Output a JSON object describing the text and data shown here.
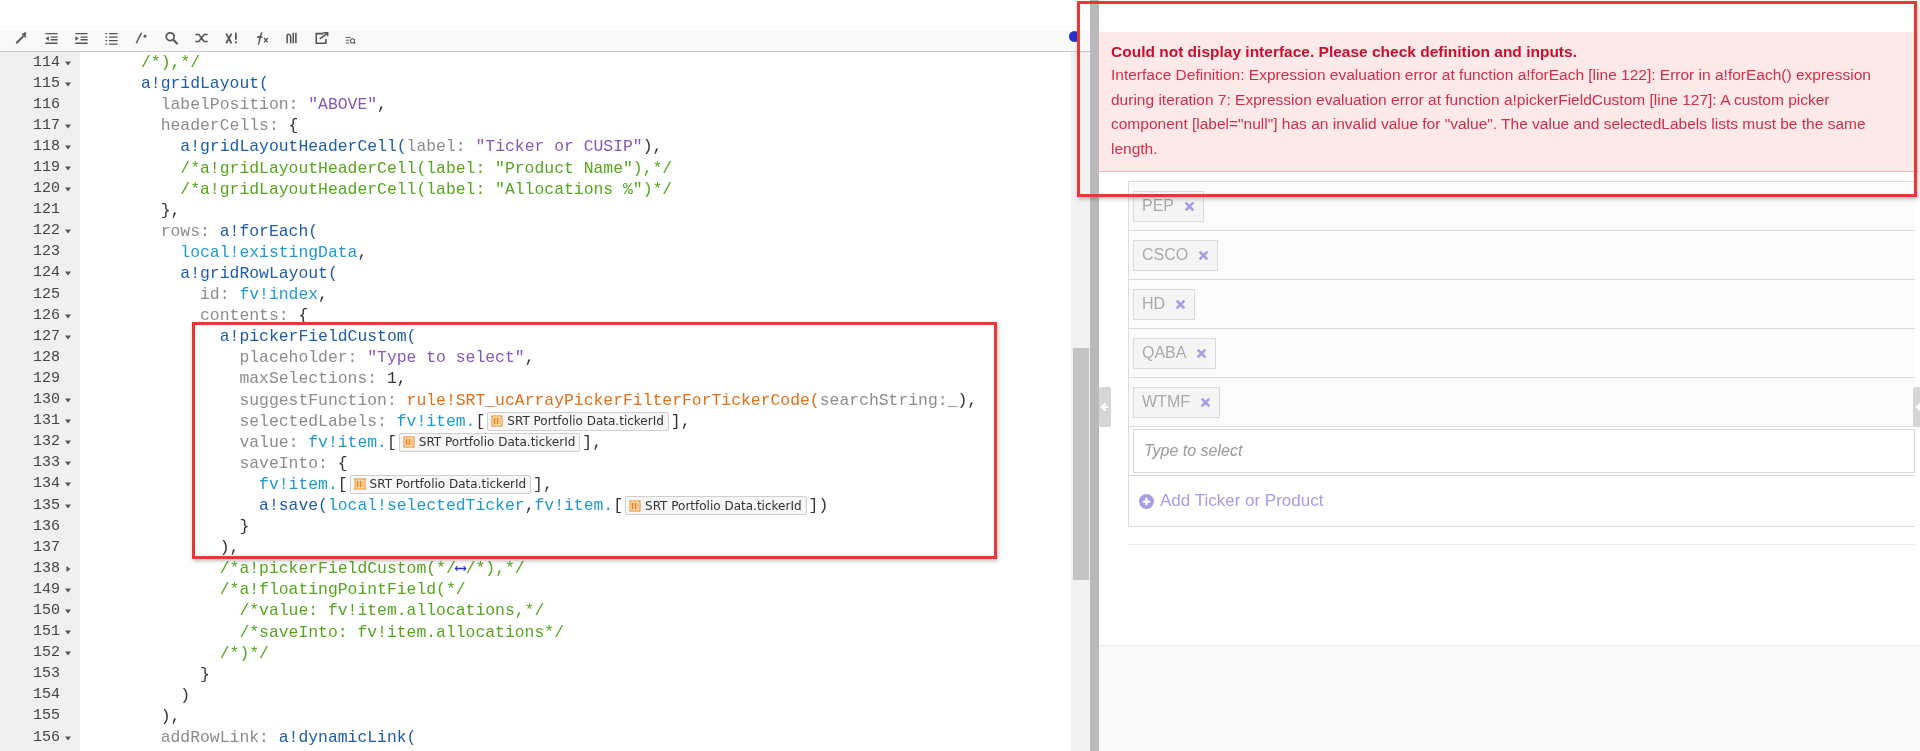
{
  "editor": {
    "lines": [
      {
        "number": "114",
        "expanded": true,
        "tokens": [
          {
            "kind": "cmt",
            "text": "      /*),*/"
          }
        ]
      },
      {
        "number": "115",
        "expanded": true,
        "tokens": [
          {
            "kind": "fn",
            "text": "      a!gridLayout("
          }
        ]
      },
      {
        "number": "116",
        "tokens": [
          {
            "kind": "key",
            "text": "        labelPosition: "
          },
          {
            "kind": "str",
            "text": "\"ABOVE\""
          },
          {
            "kind": "punct",
            "text": ","
          }
        ]
      },
      {
        "number": "117",
        "expanded": true,
        "tokens": [
          {
            "kind": "key",
            "text": "        headerCells: "
          },
          {
            "kind": "punct",
            "text": "{"
          }
        ]
      },
      {
        "number": "118",
        "expanded": true,
        "tokens": [
          {
            "kind": "fn",
            "text": "          a!gridLayoutHeaderCell("
          },
          {
            "kind": "key",
            "text": "label: "
          },
          {
            "kind": "str",
            "text": "\"Ticker or CUSIP\""
          },
          {
            "kind": "punct",
            "text": "),"
          }
        ]
      },
      {
        "number": "119",
        "expanded": true,
        "tokens": [
          {
            "kind": "cmt",
            "text": "          /*a!gridLayoutHeaderCell(label: \"Product Name\"),*/"
          }
        ]
      },
      {
        "number": "120",
        "expanded": true,
        "tokens": [
          {
            "kind": "cmt",
            "text": "          /*a!gridLayoutHeaderCell(label: \"Allocations %\")*/"
          }
        ]
      },
      {
        "number": "121",
        "tokens": [
          {
            "kind": "punct",
            "text": "        },"
          }
        ]
      },
      {
        "number": "122",
        "expanded": true,
        "tokens": [
          {
            "kind": "key",
            "text": "        rows: "
          },
          {
            "kind": "fn",
            "text": "a!forEach("
          }
        ]
      },
      {
        "number": "123",
        "tokens": [
          {
            "kind": "var",
            "text": "          local!existingData"
          },
          {
            "kind": "punct",
            "text": ","
          }
        ]
      },
      {
        "number": "124",
        "expanded": true,
        "tokens": [
          {
            "kind": "fn",
            "text": "          a!gridRowLayout("
          }
        ]
      },
      {
        "number": "125",
        "tokens": [
          {
            "kind": "key",
            "text": "            id: "
          },
          {
            "kind": "var",
            "text": "fv!index"
          },
          {
            "kind": "punct",
            "text": ","
          }
        ]
      },
      {
        "number": "126",
        "expanded": true,
        "tokens": [
          {
            "kind": "key",
            "text": "            contents: "
          },
          {
            "kind": "punct",
            "text": "{"
          }
        ]
      },
      {
        "number": "127",
        "expanded": true,
        "tokens": [
          {
            "kind": "fn",
            "text": "              a!pickerFieldCustom("
          }
        ]
      },
      {
        "number": "128",
        "tokens": [
          {
            "kind": "key",
            "text": "                placeholder: "
          },
          {
            "kind": "str",
            "text": "\"Type to select\""
          },
          {
            "kind": "punct",
            "text": ","
          }
        ]
      },
      {
        "number": "129",
        "tokens": [
          {
            "kind": "key",
            "text": "                maxSelections: "
          },
          {
            "kind": "punct",
            "text": "1,"
          }
        ]
      },
      {
        "number": "130",
        "expanded": true,
        "tokens": [
          {
            "kind": "key",
            "text": "                suggestFunction: "
          },
          {
            "kind": "rule",
            "text": "rule!SRT_ucArrayPickerFilterForTickerCode("
          },
          {
            "kind": "key",
            "text": "searchString:_"
          },
          {
            "kind": "punct",
            "text": "),"
          }
        ]
      },
      {
        "number": "131",
        "expanded": true,
        "tokens": [
          {
            "kind": "key",
            "text": "                selectedLabels: "
          },
          {
            "kind": "var",
            "text": "fv!item."
          },
          {
            "kind": "punct",
            "text": "["
          },
          {
            "kind": "rec",
            "text": "SRT Portfolio Data.tickerId"
          },
          {
            "kind": "punct",
            "text": "],"
          }
        ]
      },
      {
        "number": "132",
        "expanded": true,
        "tokens": [
          {
            "kind": "key",
            "text": "                value: "
          },
          {
            "kind": "var",
            "text": "fv!item."
          },
          {
            "kind": "punct",
            "text": "["
          },
          {
            "kind": "rec",
            "text": "SRT Portfolio Data.tickerId"
          },
          {
            "kind": "punct",
            "text": "],"
          }
        ]
      },
      {
        "number": "133",
        "expanded": true,
        "tokens": [
          {
            "kind": "key",
            "text": "                saveInto: "
          },
          {
            "kind": "punct",
            "text": "{"
          }
        ]
      },
      {
        "number": "134",
        "expanded": true,
        "tokens": [
          {
            "kind": "var",
            "text": "                  fv!item."
          },
          {
            "kind": "punct",
            "text": "["
          },
          {
            "kind": "rec",
            "text": "SRT Portfolio Data.tickerId"
          },
          {
            "kind": "punct",
            "text": "],"
          }
        ]
      },
      {
        "number": "135",
        "expanded": true,
        "tokens": [
          {
            "kind": "fn",
            "text": "                  a!save("
          },
          {
            "kind": "var",
            "text": "local!selectedTicker"
          },
          {
            "kind": "punct",
            "text": ","
          },
          {
            "kind": "var",
            "text": "fv!item."
          },
          {
            "kind": "punct",
            "text": "["
          },
          {
            "kind": "rec",
            "text": "SRT Portfolio Data.tickerId"
          },
          {
            "kind": "punct",
            "text": "])"
          }
        ]
      },
      {
        "number": "136",
        "tokens": [
          {
            "kind": "punct",
            "text": "                }"
          }
        ]
      },
      {
        "number": "137",
        "tokens": [
          {
            "kind": "punct",
            "text": "              ),"
          }
        ]
      },
      {
        "number": "138",
        "expanded": false,
        "tokens": [
          {
            "kind": "cmt",
            "text": "              /*a!pickerFieldCustom(*/"
          },
          {
            "kind": "marker",
            "text": "⟷"
          },
          {
            "kind": "cmt",
            "text": "/*),*/"
          }
        ]
      },
      {
        "number": "149",
        "expanded": true,
        "tokens": [
          {
            "kind": "cmt",
            "text": "              /*a!floatingPointField(*/"
          }
        ]
      },
      {
        "number": "150",
        "expanded": true,
        "tokens": [
          {
            "kind": "cmt",
            "text": "                /*value: fv!item.allocations,*/"
          }
        ]
      },
      {
        "number": "151",
        "expanded": true,
        "tokens": [
          {
            "kind": "cmt",
            "text": "                /*saveInto: fv!item.allocations*/"
          }
        ]
      },
      {
        "number": "152",
        "expanded": true,
        "tokens": [
          {
            "kind": "cmt",
            "text": "              /*)*/"
          }
        ]
      },
      {
        "number": "153",
        "tokens": [
          {
            "kind": "punct",
            "text": "            }"
          }
        ]
      },
      {
        "number": "154",
        "tokens": [
          {
            "kind": "punct",
            "text": "          )"
          }
        ]
      },
      {
        "number": "155",
        "tokens": [
          {
            "kind": "punct",
            "text": "        ),"
          }
        ]
      },
      {
        "number": "156",
        "expanded": true,
        "tokens": [
          {
            "kind": "key",
            "text": "        addRowLink: "
          },
          {
            "kind": "fn",
            "text": "a!dynamicLink("
          }
        ]
      }
    ]
  },
  "preview": {
    "error": {
      "title": "Could not display interface. Please check definition and inputs.",
      "message": "Interface Definition: Expression evaluation error at function a!forEach [line 122]: Error in a!forEach() expression during iteration 7: Expression evaluation error at function a!pickerFieldCustom [line 127]: A custom picker component [label=\"null\"] has an invalid value for \"value\". The value and selectedLabels lists must be the same length."
    },
    "rows": [
      {
        "tag": "PEP"
      },
      {
        "tag": "CSCO"
      },
      {
        "tag": "HD"
      },
      {
        "tag": "QABA"
      },
      {
        "tag": "WTMF"
      }
    ],
    "picker": {
      "placeholder": "Type to select"
    },
    "add_link": "Add Ticker or Product"
  }
}
